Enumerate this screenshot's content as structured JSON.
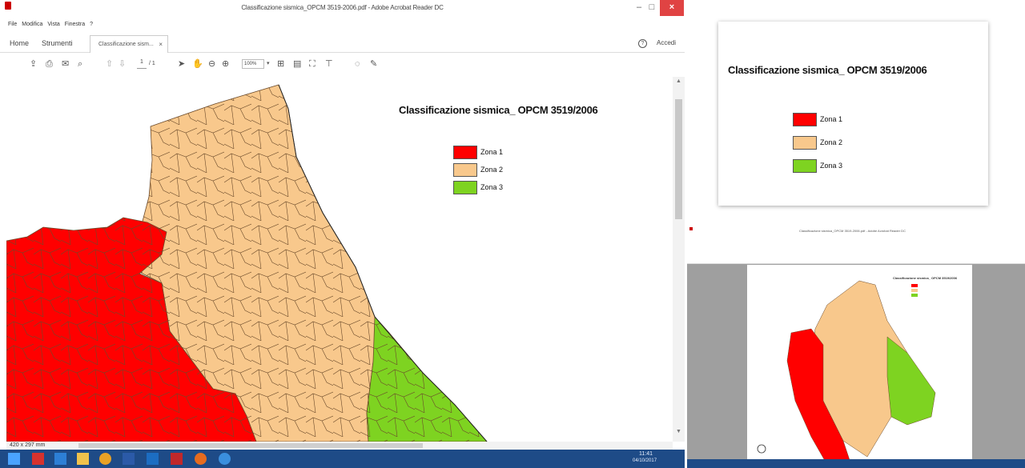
{
  "window": {
    "title": "Classificazione sismica_OPCM 3519-2006.pdf - Adobe Acrobat Reader DC",
    "controls": {
      "minimize": "–",
      "maximize": "□",
      "close": "×"
    }
  },
  "menubar": [
    "File",
    "Modifica",
    "Vista",
    "Finestra",
    "?"
  ],
  "tabs": {
    "home": "Home",
    "tools": "Strumenti",
    "document": "Classificazione sism...",
    "document_close": "×",
    "help": "?",
    "signin": "Accedi"
  },
  "toolbar": {
    "page_current": "1",
    "page_total": "/ 1",
    "zoom": "100%",
    "zoom_arrow": "▾",
    "icons": [
      "upload-icon",
      "print-icon",
      "mail-icon",
      "search-icon",
      "page-up-icon",
      "page-down-icon",
      "select-arrow-icon",
      "hand-icon",
      "zoom-out-icon",
      "zoom-in-icon",
      "fit-page-icon",
      "scroll-mode-icon",
      "fullscreen-icon",
      "form-icon",
      "comment-icon",
      "pen-icon"
    ]
  },
  "map": {
    "title": "Classificazione sismica_ OPCM 3519/2006",
    "legend": [
      {
        "label": "Zona 1",
        "color": "#ff0000"
      },
      {
        "label": "Zona 2",
        "color": "#f8c88c"
      },
      {
        "label": "Zona 3",
        "color": "#7ed321"
      }
    ]
  },
  "status": {
    "dimensions": "420 x 297 mm"
  },
  "scroll": {
    "up": "▲",
    "down": "▼"
  },
  "taskbar": {
    "icons": [
      "windows-start-icon",
      "acrobat-icon",
      "people-icon",
      "file-explorer-icon",
      "chrome-icon",
      "word-icon",
      "outlook-icon",
      "adobe-icon",
      "firefox-icon",
      "edge-icon"
    ],
    "clock_time": "11:41",
    "clock_date": "04/10/2017"
  },
  "zoom_card": {
    "title": "Classificazione sismica_ OPCM 3519/2006",
    "legend": [
      {
        "label": "Zona 1",
        "color": "#ff0000"
      },
      {
        "label": "Zona 2",
        "color": "#f8c88c"
      },
      {
        "label": "Zona 3",
        "color": "#7ed321"
      }
    ]
  },
  "thumbnail": {
    "title": "Classificazione sismica_OPCM 3519-2006.pdf - Adobe Acrobat Reader DC",
    "map_title": "Classificazione sismica_ OPCM 3519/2006"
  },
  "colors": {
    "zone1": "#ff0000",
    "zone2": "#f8c88c",
    "zone3": "#7ed321",
    "taskbar": "#1e4b87",
    "border_lines": "#6b4a2a"
  }
}
